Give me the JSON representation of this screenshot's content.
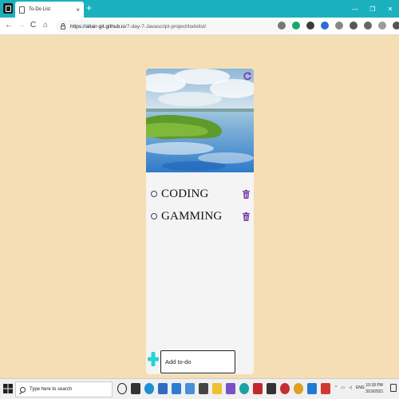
{
  "browser": {
    "tab_title": "To-Do List",
    "tab_close": "×",
    "new_tab": "+",
    "window_controls": [
      "—",
      "❐",
      "✕"
    ],
    "nav": {
      "back": "←",
      "forward": "→",
      "reload": "C",
      "home": "⌂"
    },
    "url_host": "https://altair-git.github.io",
    "url_path": "/7-day-7-Javascript-project/todolist/"
  },
  "app": {
    "todos": [
      {
        "text": "CODING"
      },
      {
        "text": "GAMMING"
      }
    ],
    "add_input_placeholder": "Add to-do",
    "colors": {
      "background": "#f5deb4",
      "card": "#f4f4f4",
      "accent_purple": "#7b3fb0",
      "add_cyan": "#25d3d6"
    },
    "icons": {
      "refresh": "refresh-icon",
      "trash": "trash-icon",
      "add": "plus-icon",
      "check": "circle-icon"
    }
  },
  "taskbar": {
    "search_placeholder": "Type here to search",
    "tray_lang": "ENG",
    "time": "10:18 PM",
    "date": "3/19/2021"
  }
}
